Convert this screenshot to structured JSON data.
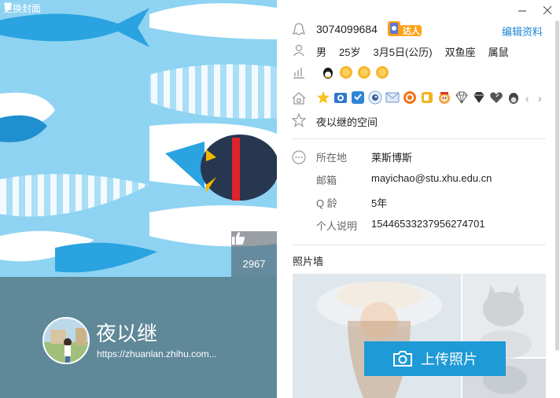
{
  "cover": {
    "change_cover_label": "更换封面",
    "like_count": "2967"
  },
  "profile": {
    "nickname": "夜以继",
    "homepage": "https://zhuanlan.zhihu.com..."
  },
  "header": {
    "qq_number": "3074099684",
    "badge_label": "达人",
    "edit_label": "编辑资料"
  },
  "basic": {
    "gender": "男",
    "age": "25岁",
    "birthday": "3月5日(公历)",
    "constellation": "双鱼座",
    "zodiac": "属鼠"
  },
  "level_icons": [
    "penguin-icon",
    "sun-icon",
    "sun-icon",
    "sun-icon"
  ],
  "services": [
    "star-icon",
    "camera-icon",
    "shield-icon",
    "eye-icon",
    "mail-icon",
    "music-icon",
    "coin-icon",
    "cartoon-icon",
    "diamond-icon",
    "diamond-dark-icon",
    "heart-icon",
    "penguin-icon"
  ],
  "space_label": "夜以继的空间",
  "details": {
    "location_label": "所在地",
    "location_value": "莱斯博斯",
    "email_label": "邮箱",
    "email_value": "mayichao@stu.xhu.edu.cn",
    "qage_label": "Q 龄",
    "qage_value": "5年",
    "bio_label": "个人说明",
    "bio_value": "15446533237956274701"
  },
  "photos": {
    "title": "照片墙",
    "upload_label": "上传照片"
  },
  "colors": {
    "accent": "#1e9ad6",
    "link": "#1b87d7",
    "profile_band": "#5f8899",
    "cover_bg": "#8ed3f2"
  }
}
